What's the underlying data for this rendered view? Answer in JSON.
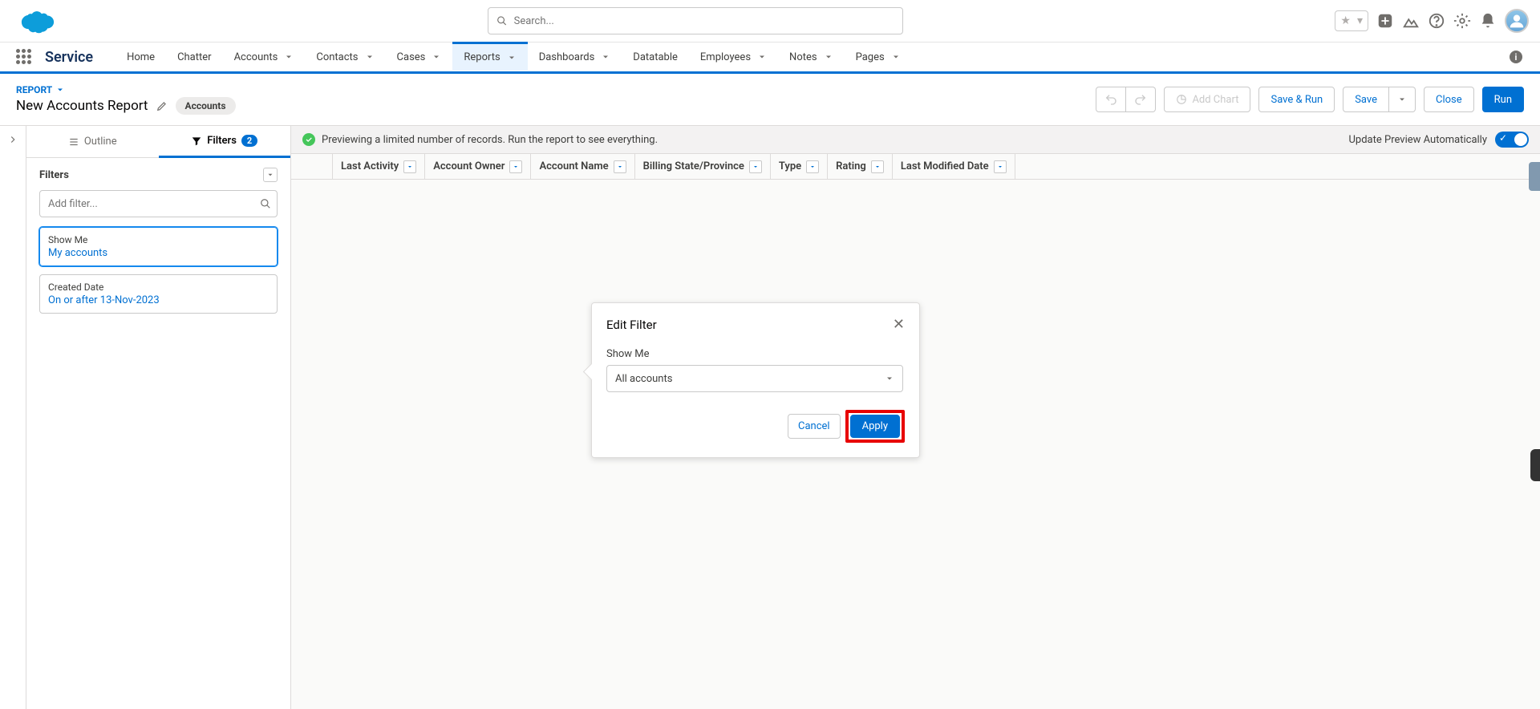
{
  "header": {
    "search_placeholder": "Search..."
  },
  "nav": {
    "app_name": "Service",
    "items": [
      {
        "label": "Home",
        "dd": false
      },
      {
        "label": "Chatter",
        "dd": false
      },
      {
        "label": "Accounts",
        "dd": true
      },
      {
        "label": "Contacts",
        "dd": true
      },
      {
        "label": "Cases",
        "dd": true
      },
      {
        "label": "Reports",
        "dd": true,
        "active": true
      },
      {
        "label": "Dashboards",
        "dd": true
      },
      {
        "label": "Datatable",
        "dd": false
      },
      {
        "label": "Employees",
        "dd": true
      },
      {
        "label": "Notes",
        "dd": true
      },
      {
        "label": "Pages",
        "dd": true
      }
    ]
  },
  "report_bar": {
    "tag": "REPORT",
    "title": "New Accounts Report",
    "pill": "Accounts",
    "add_chart": "Add Chart",
    "save_run": "Save & Run",
    "save": "Save",
    "close": "Close",
    "run": "Run"
  },
  "sidebar": {
    "tab_outline": "Outline",
    "tab_filters": "Filters",
    "filter_count": "2",
    "heading": "Filters",
    "add_filter_placeholder": "Add filter...",
    "cards": [
      {
        "label": "Show Me",
        "value": "My accounts",
        "active": true
      },
      {
        "label": "Created Date",
        "value": "On or after 13-Nov-2023",
        "active": false
      }
    ]
  },
  "preview": {
    "msg": "Previewing a limited number of records. Run the report to see everything.",
    "auto": "Update Preview Automatically"
  },
  "columns": [
    "Last Activity",
    "Account Owner",
    "Account Name",
    "Billing State/Province",
    "Type",
    "Rating",
    "Last Modified Date"
  ],
  "popover": {
    "title": "Edit Filter",
    "field_label": "Show Me",
    "field_value": "All accounts",
    "cancel": "Cancel",
    "apply": "Apply"
  }
}
